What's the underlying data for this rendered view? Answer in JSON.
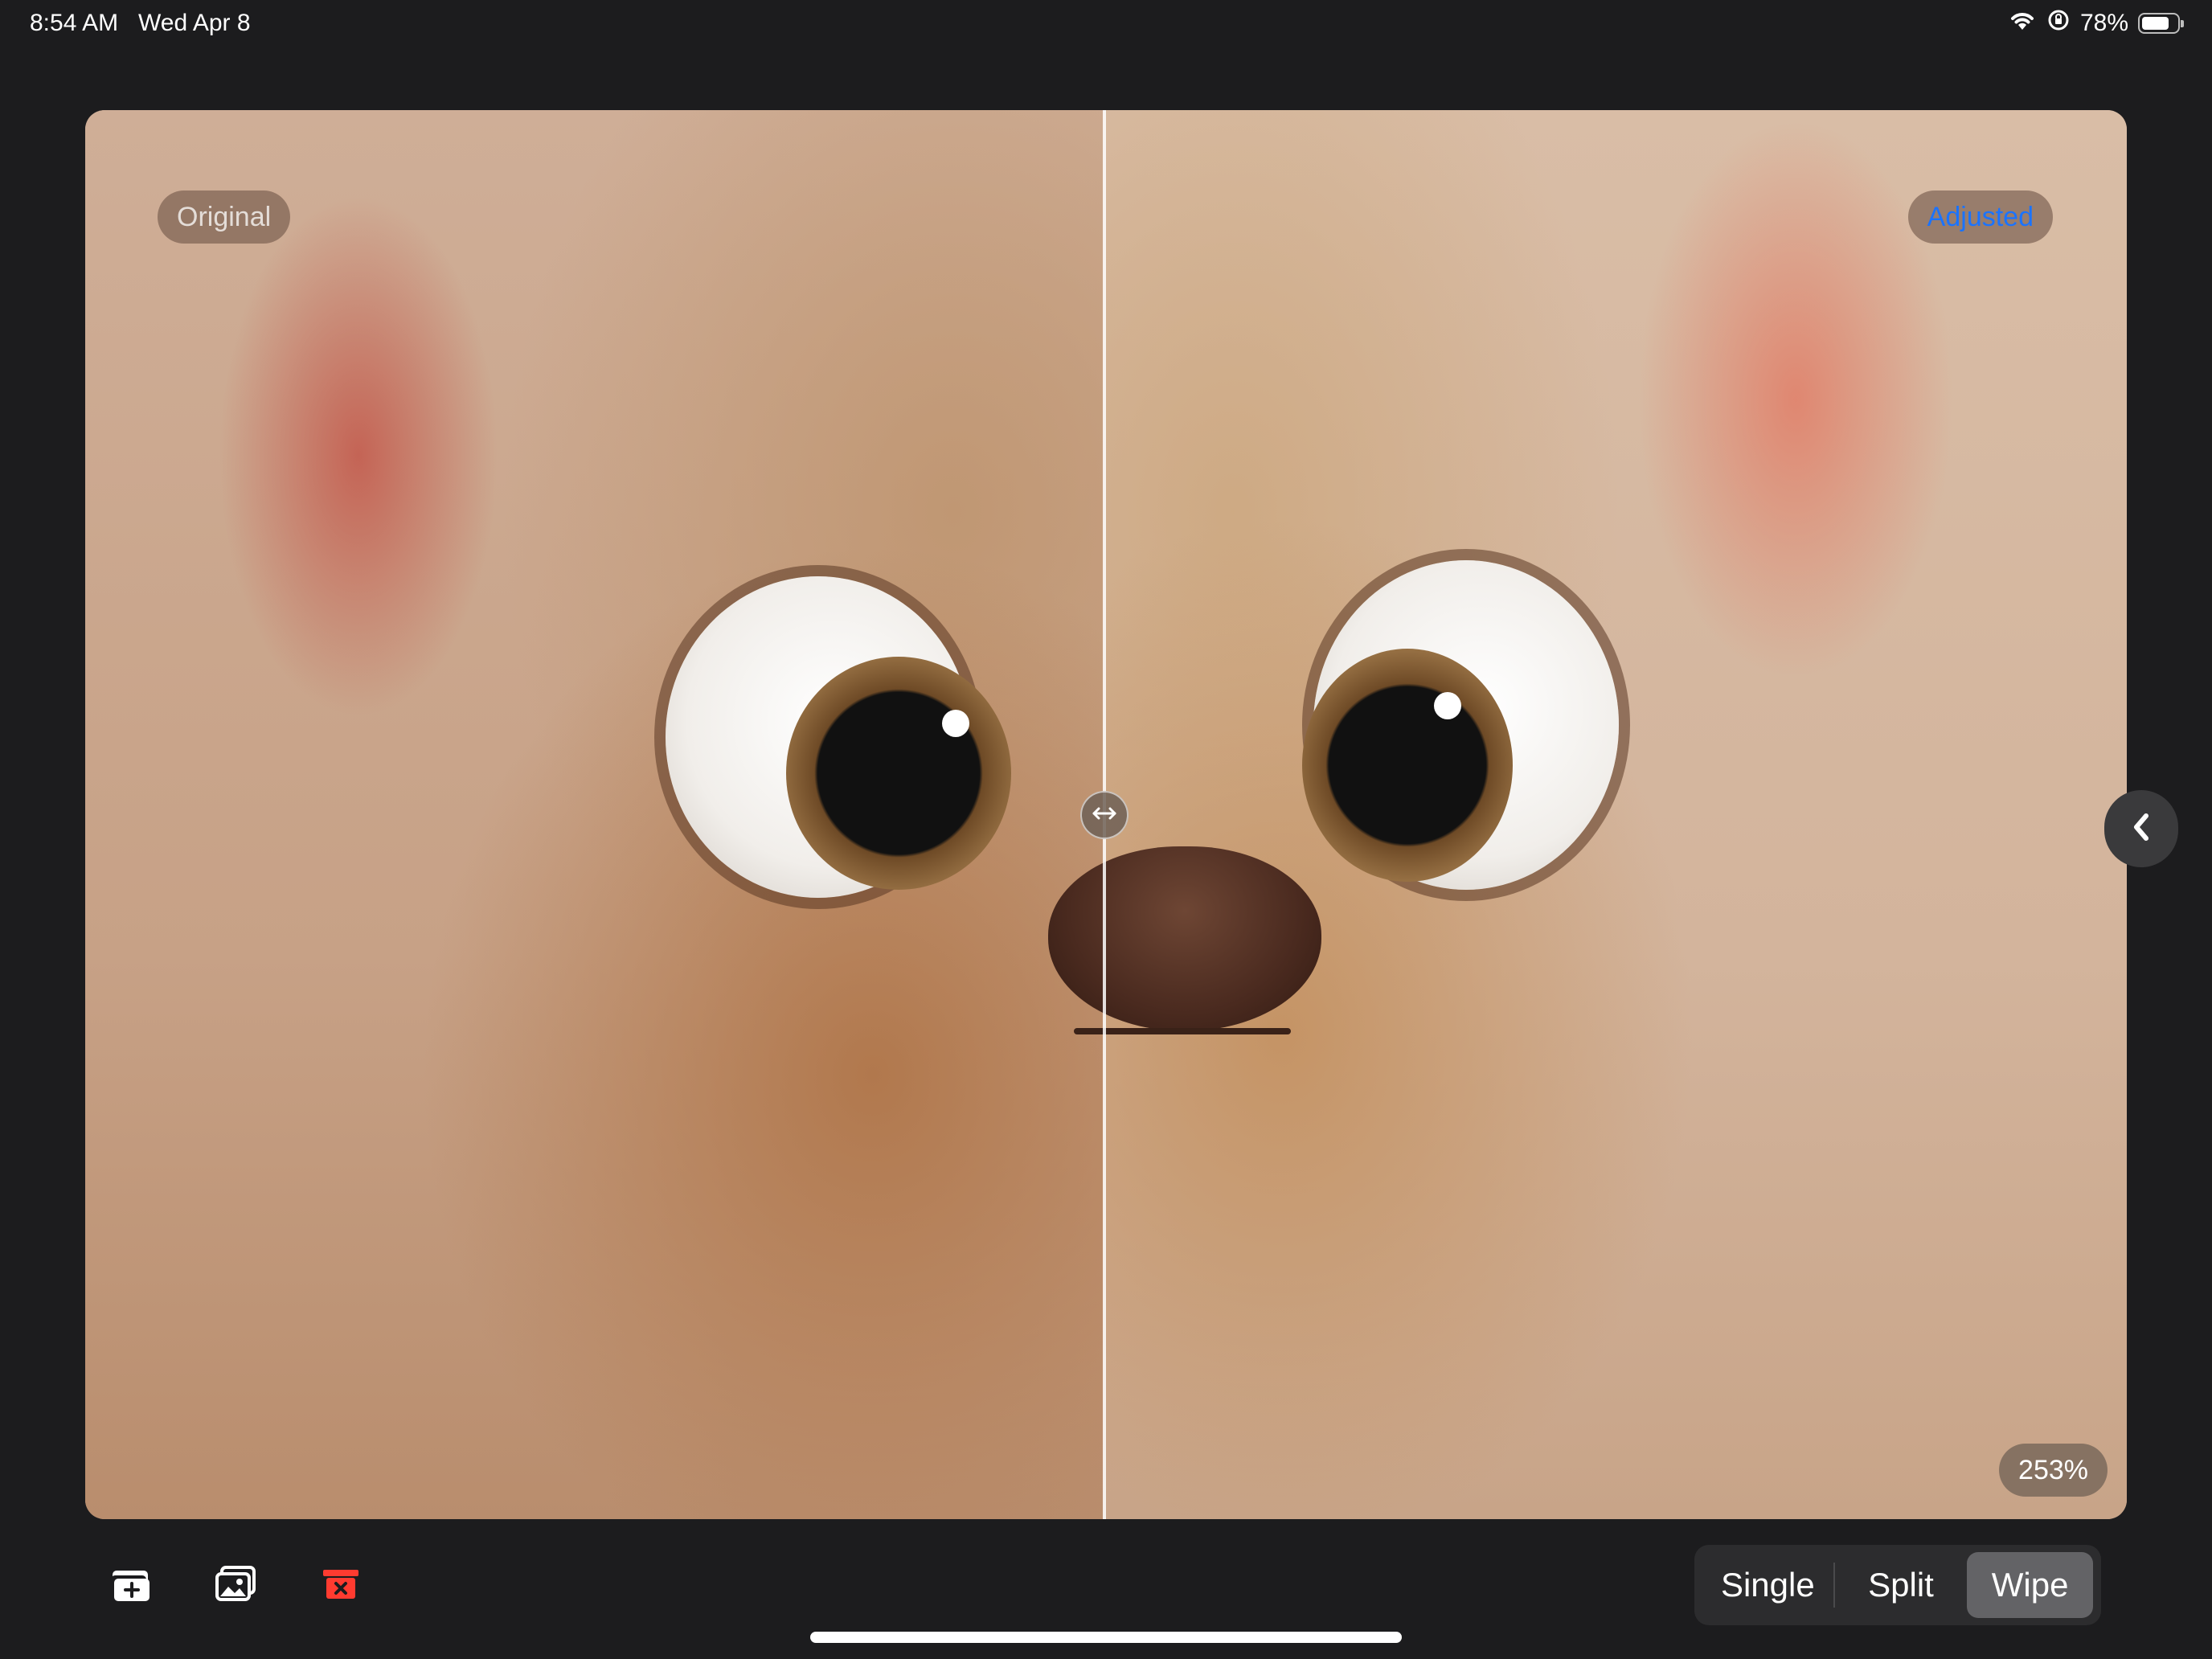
{
  "status_bar": {
    "time": "8:54 AM",
    "date": "Wed Apr 8",
    "battery_text": "78%",
    "battery_level": 0.78,
    "icons": [
      "wifi-icon",
      "orientation-lock-icon",
      "battery-icon"
    ]
  },
  "viewer": {
    "original_label": "Original",
    "adjusted_label": "Adjusted",
    "zoom_label": "253%",
    "wipe_position": 0.5,
    "handle_icon": "left-right-arrows-icon",
    "collapse_icon": "chevron-left-icon"
  },
  "toolbar": {
    "icons": [
      "add-photo-icon",
      "photo-library-icon",
      "delete-icon"
    ],
    "delete_color": "#ff3b30"
  },
  "view_modes": {
    "options": [
      "Single",
      "Split",
      "Wipe"
    ],
    "selected": "Wipe"
  }
}
